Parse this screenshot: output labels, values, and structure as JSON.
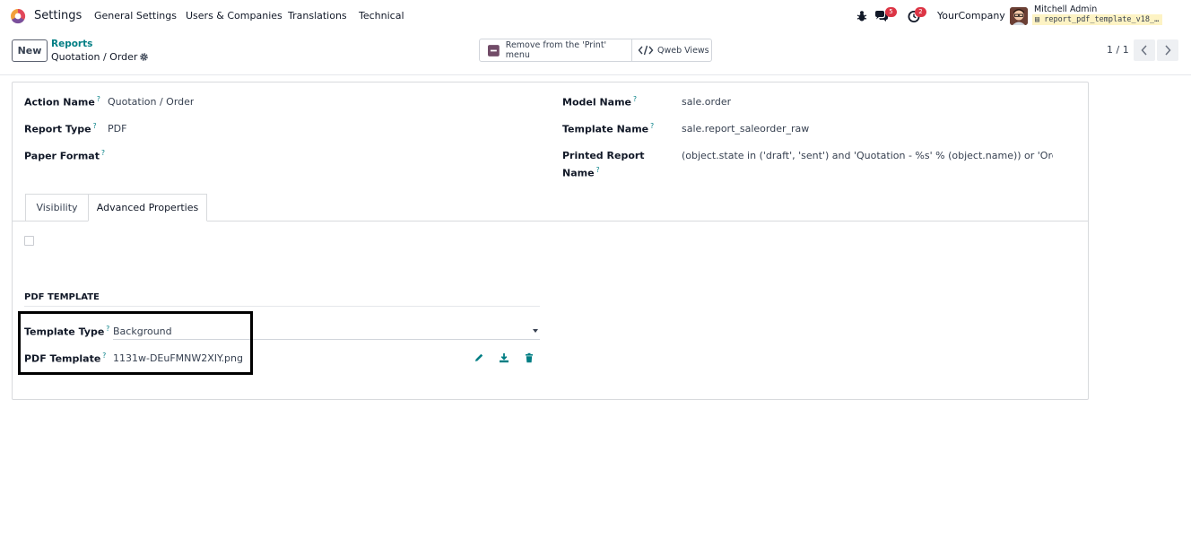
{
  "navbar": {
    "app_name": "Settings",
    "menu": [
      "General Settings",
      "Users & Companies",
      "Translations",
      "Technical"
    ],
    "messages_count": "5",
    "activities_count": "2",
    "company": "YourCompany",
    "user_name": "Mitchell Admin",
    "database": "report_pdf_template_v18_…"
  },
  "control_panel": {
    "new_label": "New",
    "breadcrumb_parent": "Reports",
    "breadcrumb_current": "Quotation / Order",
    "remove_print_label": "Remove from the 'Print' menu",
    "qweb_views_label": "Qweb Views",
    "pager": "1 / 1"
  },
  "form": {
    "action_name_label": "Action Name",
    "action_name_value": "Quotation / Order",
    "report_type_label": "Report Type",
    "report_type_value": "PDF",
    "paper_format_label": "Paper Format",
    "model_name_label": "Model Name",
    "model_name_value": "sale.order",
    "template_name_label": "Template Name",
    "template_name_value": "sale.report_saleorder_raw",
    "printed_report_label_line1": "Printed Report",
    "printed_report_label_line2": "Name",
    "printed_report_value": "(object.state in ('draft', 'sent') and 'Quotation - %s' % (object.name)) or 'Order - %s",
    "help_mark": "?"
  },
  "tabs": [
    "Visibility",
    "Advanced Properties"
  ],
  "pdf_template": {
    "section_title": "PDF TEMPLATE",
    "template_type_label": "Template Type",
    "template_type_value": "Background",
    "pdf_template_label": "PDF Template",
    "pdf_template_value": "1131w-DEuFMNW2XIY.png"
  },
  "colors": {
    "accent": "#017e84",
    "badge": "#dc3545",
    "highlight_border": "#000000",
    "action_icon": "#714b67"
  }
}
